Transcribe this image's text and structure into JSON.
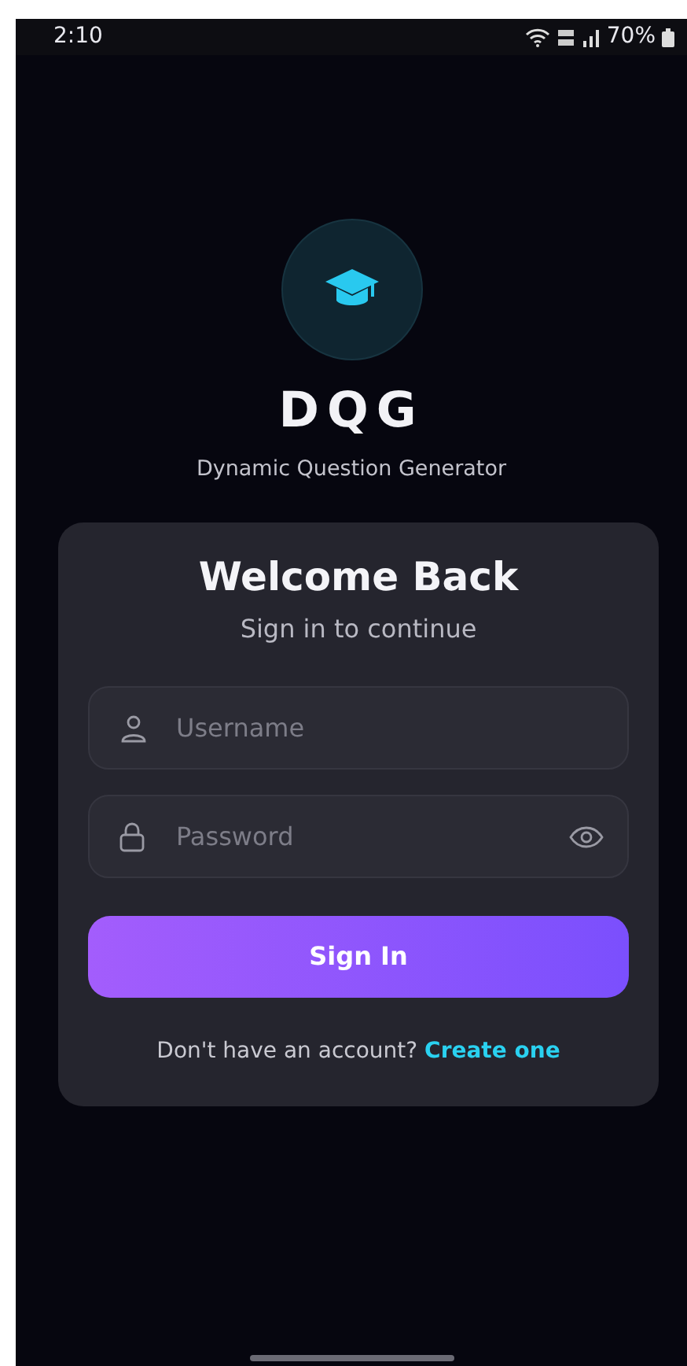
{
  "status_bar": {
    "time": "2:10",
    "battery": "70%"
  },
  "app": {
    "title": "DQG",
    "subtitle": "Dynamic Question Generator"
  },
  "card": {
    "heading": "Welcome Back",
    "subheading": "Sign in to continue",
    "fields": [
      {
        "kind": "text",
        "placeholder": "Username",
        "reveal_toggle": false
      },
      {
        "kind": "password",
        "placeholder": "Password",
        "reveal_toggle": true
      }
    ],
    "submit": "Sign In",
    "footer": {
      "text": "Don't have an account?",
      "link": "Create one"
    }
  }
}
